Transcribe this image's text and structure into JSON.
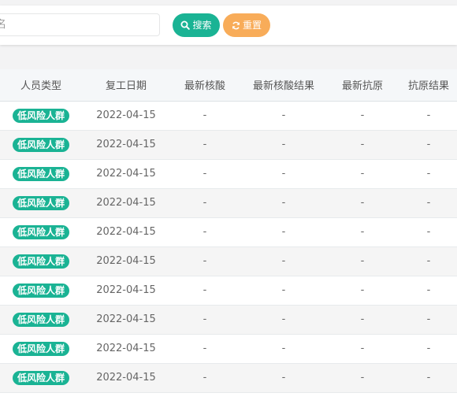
{
  "search": {
    "name_placeholder": "名",
    "search_label": "搜索",
    "reset_label": "重置"
  },
  "table": {
    "headers": [
      "人员类型",
      "复工日期",
      "最新核酸",
      "最新核酸结果",
      "最新抗原",
      "抗原结果"
    ],
    "rows": [
      {
        "type": "低风险人群",
        "date": "2022-04-15",
        "latest_nucleic": "-",
        "nucleic_result": "-",
        "latest_antigen": "-",
        "antigen_result": "-"
      },
      {
        "type": "低风险人群",
        "date": "2022-04-15",
        "latest_nucleic": "-",
        "nucleic_result": "-",
        "latest_antigen": "-",
        "antigen_result": "-"
      },
      {
        "type": "低风险人群",
        "date": "2022-04-15",
        "latest_nucleic": "-",
        "nucleic_result": "-",
        "latest_antigen": "-",
        "antigen_result": "-"
      },
      {
        "type": "低风险人群",
        "date": "2022-04-15",
        "latest_nucleic": "-",
        "nucleic_result": "-",
        "latest_antigen": "-",
        "antigen_result": "-"
      },
      {
        "type": "低风险人群",
        "date": "2022-04-15",
        "latest_nucleic": "-",
        "nucleic_result": "-",
        "latest_antigen": "-",
        "antigen_result": "-"
      },
      {
        "type": "低风险人群",
        "date": "2022-04-15",
        "latest_nucleic": "-",
        "nucleic_result": "-",
        "latest_antigen": "-",
        "antigen_result": "-"
      },
      {
        "type": "低风险人群",
        "date": "2022-04-15",
        "latest_nucleic": "-",
        "nucleic_result": "-",
        "latest_antigen": "-",
        "antigen_result": "-"
      },
      {
        "type": "低风险人群",
        "date": "2022-04-15",
        "latest_nucleic": "-",
        "nucleic_result": "-",
        "latest_antigen": "-",
        "antigen_result": "-"
      },
      {
        "type": "低风险人群",
        "date": "2022-04-15",
        "latest_nucleic": "-",
        "nucleic_result": "-",
        "latest_antigen": "-",
        "antigen_result": "-"
      },
      {
        "type": "低风险人群",
        "date": "2022-04-15",
        "latest_nucleic": "-",
        "nucleic_result": "-",
        "latest_antigen": "-",
        "antigen_result": "-"
      }
    ]
  },
  "colors": {
    "primary": "#1ab394",
    "warning": "#f8ac59"
  },
  "icons": {
    "search": "search-icon",
    "reset": "refresh-icon"
  }
}
